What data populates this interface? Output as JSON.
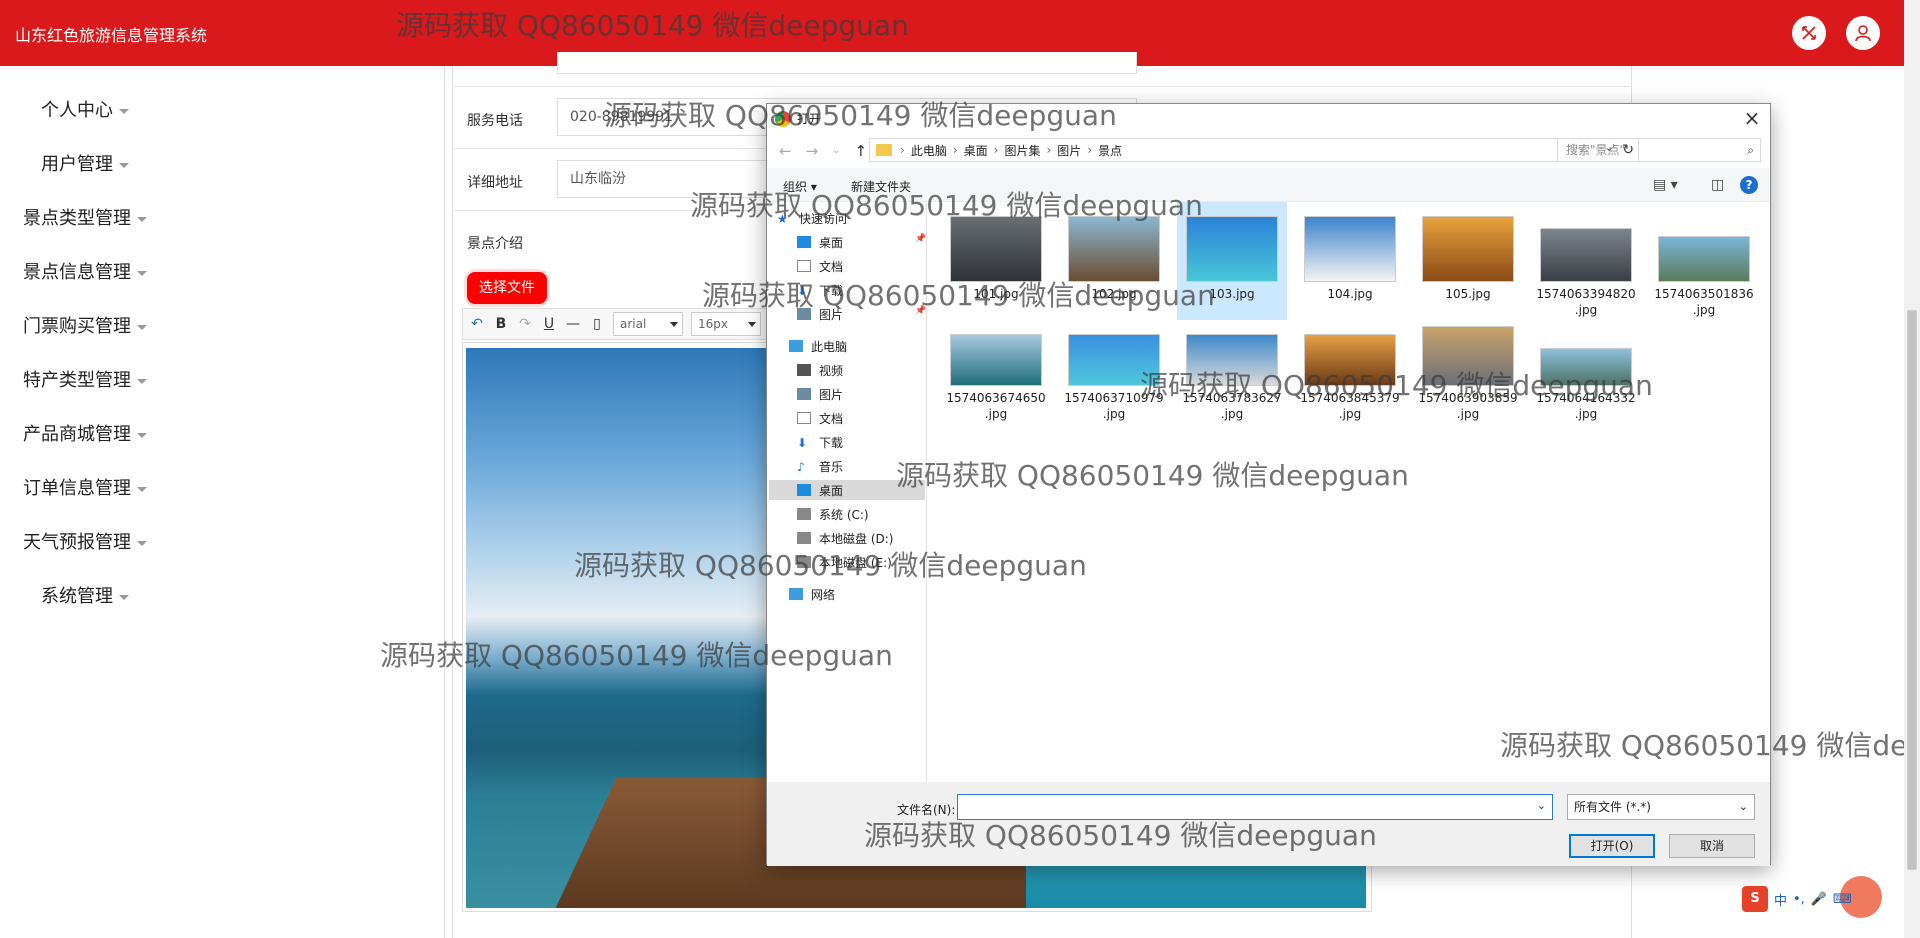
{
  "app": {
    "title": "山东红色旅游信息管理系统"
  },
  "topbar": {
    "fullscreen_icon": "expand-icon",
    "user_icon": "user-icon"
  },
  "sidebar": {
    "items": [
      {
        "label": "个人中心"
      },
      {
        "label": "用户管理"
      },
      {
        "label": "景点类型管理"
      },
      {
        "label": "景点信息管理"
      },
      {
        "label": "门票购买管理"
      },
      {
        "label": "特产类型管理"
      },
      {
        "label": "产品商城管理"
      },
      {
        "label": "订单信息管理"
      },
      {
        "label": "天气预报管理"
      },
      {
        "label": "系统管理"
      }
    ]
  },
  "form": {
    "phone_label": "服务电话",
    "phone_value": "020-89819991",
    "address_label": "详细地址",
    "address_value": "山东临汾",
    "intro_label": "景点介绍",
    "upload_button": "选择文件",
    "font_family": "arial",
    "font_size": "16px"
  },
  "dialog": {
    "title": "打开",
    "breadcrumb": [
      "此电脑",
      "桌面",
      "图片集",
      "图片",
      "景点"
    ],
    "search_placeholder": "搜索\"景点\"",
    "organize": "组织 ▾",
    "new_folder": "新建文件夹",
    "nav": {
      "quick_access": "快速访问",
      "desktop": "桌面",
      "documents": "文档",
      "downloads": "下载",
      "pictures": "图片",
      "this_pc": "此电脑",
      "videos": "视频",
      "pictures2": "图片",
      "documents2": "文档",
      "downloads2": "下载",
      "music": "音乐",
      "desktop2": "桌面",
      "drive_c": "系统 (C:)",
      "drive_d": "本地磁盘 (D:)",
      "drive_e": "本地磁盘 (E:)",
      "network": "网络"
    },
    "files": [
      {
        "name": "101.jpg",
        "colors": [
          "#6a6f74",
          "#2e3237"
        ]
      },
      {
        "name": "102.jpg",
        "colors": [
          "#8bb7d1",
          "#6b4d33"
        ]
      },
      {
        "name": "103.jpg",
        "colors": [
          "#2b82d8",
          "#49c6d8"
        ]
      },
      {
        "name": "104.jpg",
        "colors": [
          "#3d84cc",
          "#f4f4f4"
        ]
      },
      {
        "name": "105.jpg",
        "colors": [
          "#e9a13b",
          "#8a4b17"
        ]
      },
      {
        "name": "1574063394820\n.jpg",
        "colors": [
          "#7c858c",
          "#3a3f45"
        ]
      },
      {
        "name": "1574063501836\n.jpg",
        "colors": [
          "#7bb5d8",
          "#5a7c59"
        ]
      },
      {
        "name": "1574063674650\n.jpg",
        "colors": [
          "#a8c8de",
          "#1f6f7a"
        ]
      },
      {
        "name": "1574063710979\n.jpg",
        "colors": [
          "#3a8fe0",
          "#4fc8dc"
        ]
      },
      {
        "name": "1574063783627\n.jpg",
        "colors": [
          "#3e8acb",
          "#d9d9d9"
        ]
      },
      {
        "name": "1574063845379\n.jpg",
        "colors": [
          "#e7a045",
          "#6a3a17"
        ]
      },
      {
        "name": "1574063903859\n.jpg",
        "colors": [
          "#c9a36a",
          "#6b6f78"
        ]
      },
      {
        "name": "1574064164332\n.jpg",
        "colors": [
          "#8cc1dc",
          "#4e7263"
        ]
      }
    ],
    "filename_label": "文件名(N):",
    "filename_value": "",
    "filetype": "所有文件 (*.*)",
    "open_button": "打开(O)",
    "cancel_button": "取消"
  },
  "watermark": "源码获取 QQ86050149 微信deepguan",
  "ime": {
    "lang": "中",
    "punct": "•,",
    "mic": "🎤",
    "kbd": "⌨"
  }
}
